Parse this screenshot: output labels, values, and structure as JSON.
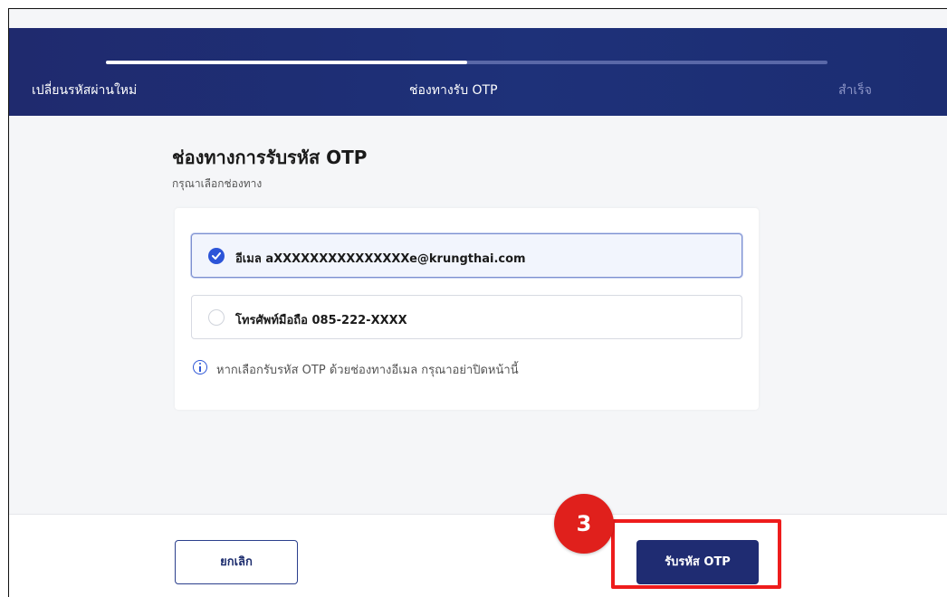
{
  "stepper": {
    "steps": [
      {
        "label": "เปลี่ยนรหัสผ่านใหม่",
        "state": "done"
      },
      {
        "label": "ช่องทางรับ OTP",
        "state": "current"
      },
      {
        "label": "สำเร็จ",
        "state": "pending"
      }
    ],
    "progress_fraction": 0.5
  },
  "main": {
    "title": "ช่องทางการรับรหัส OTP",
    "subtitle": "กรุณาเลือกช่องทาง",
    "options": [
      {
        "label": "อีเมล aXXXXXXXXXXXXXXXe@krungthai.com",
        "selected": true
      },
      {
        "label": "โทรศัพท์มือถือ 085-222-XXXX",
        "selected": false
      }
    ],
    "info_text": "หากเลือกรับรหัส OTP ด้วยช่องทางอีเมล กรุณาอย่าปิดหน้านี้"
  },
  "footer": {
    "cancel_label": "ยกเลิก",
    "request_otp_label": "รับรหัส OTP"
  },
  "annotation": {
    "step_number": "3",
    "color": "#e0201c"
  },
  "colors": {
    "header_bg": "#1f2a6e",
    "accent": "#2c54d8",
    "primary_button": "#1f2c72"
  }
}
